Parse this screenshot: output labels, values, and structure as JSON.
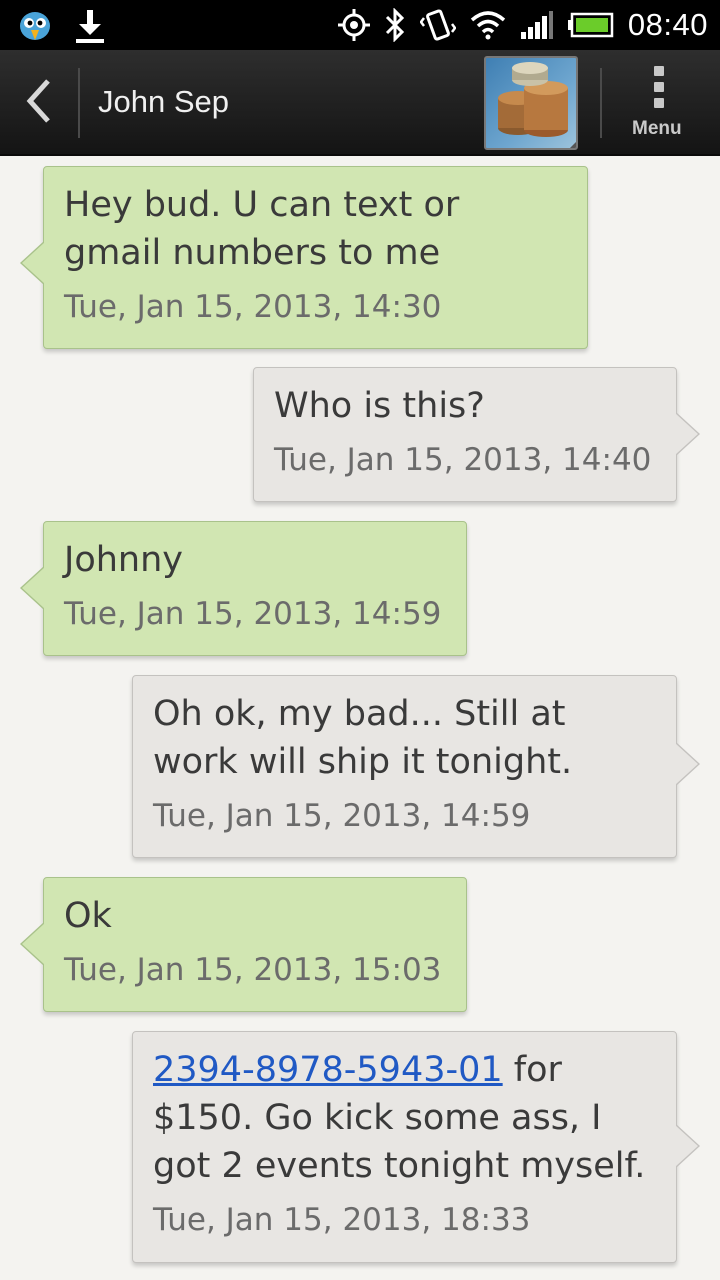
{
  "status_bar": {
    "left_icons": [
      "bird-notification-icon",
      "download-icon"
    ],
    "right_icons": [
      "gps-icon",
      "bluetooth-icon",
      "vibrate-icon",
      "wifi-icon",
      "signal-icon",
      "battery-icon"
    ],
    "time": "08:40"
  },
  "header": {
    "title": "John Sep",
    "menu_label": "Menu",
    "icons": {
      "back": "chevron-left-icon",
      "menu": "overflow-menu-icon"
    }
  },
  "messages": [
    {
      "direction": "incoming",
      "text": "Hey bud. U can text or gmail numbers to me",
      "line1": "Hey bud. U can text or",
      "line2": "gmail numbers to me",
      "timestamp": "Tue, Jan 15, 2013, 14:30"
    },
    {
      "direction": "outgoing",
      "text": "Who is this?",
      "timestamp": "Tue, Jan 15, 2013, 14:40"
    },
    {
      "direction": "incoming",
      "text": "Johnny",
      "timestamp": "Tue, Jan 15, 2013, 14:59"
    },
    {
      "direction": "outgoing",
      "text": "Oh ok, my bad... Still at work will ship it tonight.",
      "line1": "Oh ok, my bad... Still at",
      "line2": "work will ship it tonight.",
      "timestamp": "Tue, Jan 15, 2013, 14:59"
    },
    {
      "direction": "incoming",
      "text": "Ok",
      "timestamp": "Tue, Jan 15, 2013, 15:03"
    },
    {
      "direction": "outgoing",
      "link": "2394-8978-5943-01",
      "line1_rest": " for",
      "line2": "$150. Go kick some ass, I",
      "line3": "got 2 events tonight myself.",
      "timestamp": "Tue, Jan 15, 2013, 18:33"
    }
  ],
  "colors": {
    "incoming_bubble": "#d1e6b2",
    "outgoing_bubble": "#e8e6e3",
    "link": "#2059c4",
    "background": "#f4f3f0"
  }
}
